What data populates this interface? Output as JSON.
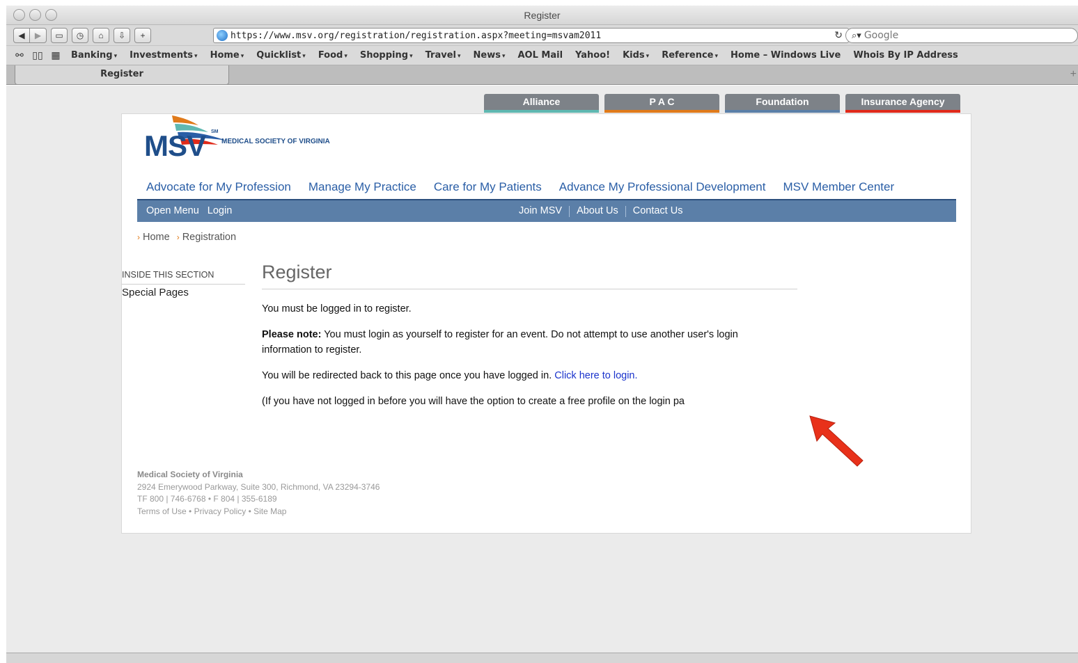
{
  "browser": {
    "window_title": "Register",
    "url": "https://www.msv.org/registration/registration.aspx?meeting=msvam2011",
    "search_placeholder": "Google",
    "bookmarks": [
      {
        "label": "Banking",
        "menu": true
      },
      {
        "label": "Investments",
        "menu": true
      },
      {
        "label": "Home",
        "menu": true
      },
      {
        "label": "Quicklist",
        "menu": true
      },
      {
        "label": "Food",
        "menu": true
      },
      {
        "label": "Shopping",
        "menu": true
      },
      {
        "label": "Travel",
        "menu": true
      },
      {
        "label": "News",
        "menu": true
      },
      {
        "label": "AOL Mail",
        "menu": false
      },
      {
        "label": "Yahoo!",
        "menu": false
      },
      {
        "label": "Kids",
        "menu": true
      },
      {
        "label": "Reference",
        "menu": true
      },
      {
        "label": "Home – Windows Live",
        "menu": false
      },
      {
        "label": "Whois By IP Address",
        "menu": false
      }
    ],
    "tab_label": "Register"
  },
  "site": {
    "top_tabs": [
      {
        "label": "Alliance",
        "color": "#7d8288",
        "accent": "#5fb8b1"
      },
      {
        "label": "P A C",
        "color": "#7d8288",
        "accent": "#e07a1a"
      },
      {
        "label": "Foundation",
        "color": "#7d8288",
        "accent": "#5b7fa8"
      },
      {
        "label": "Insurance Agency",
        "color": "#7d8288",
        "accent": "#e02a1a"
      }
    ],
    "logo_text": "MSV",
    "logo_sm": "SM",
    "logo_subtitle": "MEDICAL SOCIETY OF VIRGINIA",
    "main_nav": [
      "Advocate for My Profession",
      "Manage My Practice",
      "Care for My Patients",
      "Advance My Professional Development",
      "MSV Member Center"
    ],
    "navbar": {
      "open_menu": "Open Menu",
      "login": "Login",
      "join": "Join MSV",
      "about": "About Us",
      "contact": "Contact Us"
    },
    "breadcrumb": {
      "home": "Home",
      "current": "Registration"
    },
    "sidebar": {
      "heading": "INSIDE THIS SECTION",
      "item": "Special Pages"
    },
    "page_title": "Register",
    "para1": "You must be logged in to register.",
    "para2_bold": "Please note:",
    "para2_rest": " You must login as yourself to register for an event. Do not attempt to use another user's login information to register.",
    "para3_text": "You will be redirected back to this page once you have logged in. ",
    "para3_link": "Click here to login.",
    "para4": "(If you have not logged in before you will have the option to create a free profile on the login pa",
    "footer": {
      "name": "Medical Society of Virginia",
      "address": "2924 Emerywood Parkway, Suite 300, Richmond, VA 23294-3746",
      "phones": "TF 800 | 746-6768 • F 804 | 355-6189",
      "terms": "Terms of Use",
      "privacy": "Privacy Policy",
      "sitemap": "Site Map",
      "bullet": " • "
    },
    "accent_colors": {
      "nav_blue": "#5b7fa8",
      "link_blue": "#2a5ea6",
      "arrow_red": "#e8311a"
    }
  }
}
